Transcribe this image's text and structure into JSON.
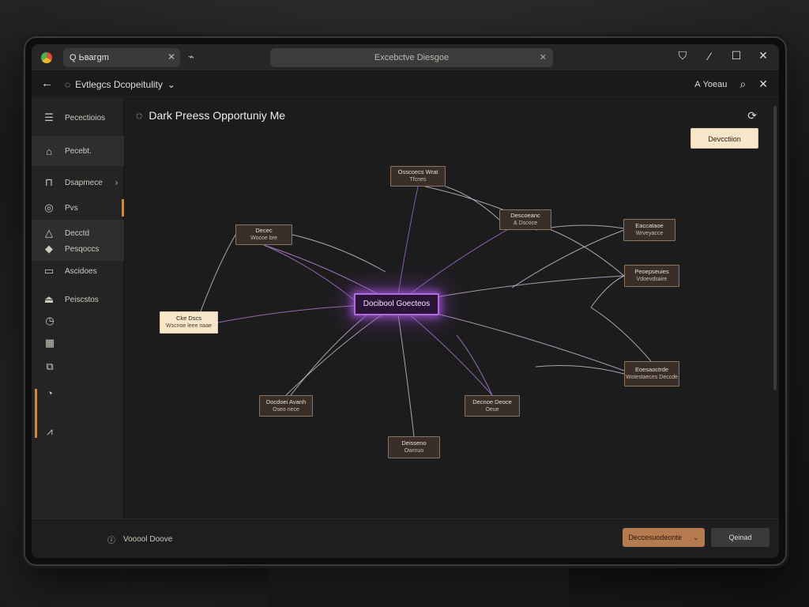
{
  "browser": {
    "tab_title": "Q  Ьвагgm",
    "address_text": "Excebctve Diesgoe"
  },
  "appbar": {
    "breadcrumb": "Evtlegcs Dcopeitulity",
    "user_label": "Yoeau"
  },
  "sidebar": {
    "items": [
      {
        "label": "Pecectioios",
        "icon": "list-icon"
      },
      {
        "label": "Pecebt.",
        "icon": "home-icon"
      },
      {
        "label": "Dsapmece",
        "icon": "bag-icon"
      },
      {
        "label": "Pvs",
        "icon": "compass-icon"
      },
      {
        "label": "Decctd",
        "icon": "triangle-icon"
      },
      {
        "label": "Pesqoccs",
        "icon": "diamond-icon"
      },
      {
        "label": "Ascidoes",
        "icon": "doc-icon"
      },
      {
        "label": "Peiscstos",
        "icon": "bell-icon"
      }
    ]
  },
  "canvas": {
    "title": "Dark Preess Opportuniy Me",
    "top_button": "Devcctiion",
    "hub": "Docibool Goecteos",
    "nodes": [
      {
        "title": "Osscoecs Wrat",
        "sub": "Tfcnes"
      },
      {
        "title": "Descoeanc",
        "sub": "& Dscoce"
      },
      {
        "title": "Decec",
        "sub": "Wocoe bre"
      },
      {
        "title": "Eaccataoe",
        "sub": "Wrveyacce"
      },
      {
        "title": "Peoepseuies",
        "sub": "Vdoevdsaire"
      },
      {
        "title": "Cke Dscs",
        "sub": "Wscnoe leee naae"
      },
      {
        "title": "Eoesaoctrde",
        "sub": "Wotestaeces Deccde"
      },
      {
        "title": "Docdoei Avanh",
        "sub": "Oseo nece"
      },
      {
        "title": "Decnoe Deoce",
        "sub": "Oeue"
      },
      {
        "title": "Deisseno",
        "sub": "Owrnuo"
      }
    ]
  },
  "footer": {
    "status": "Vooool Doove",
    "primary_button": "Deccesuodeonte",
    "secondary_button": "Qeinad"
  }
}
